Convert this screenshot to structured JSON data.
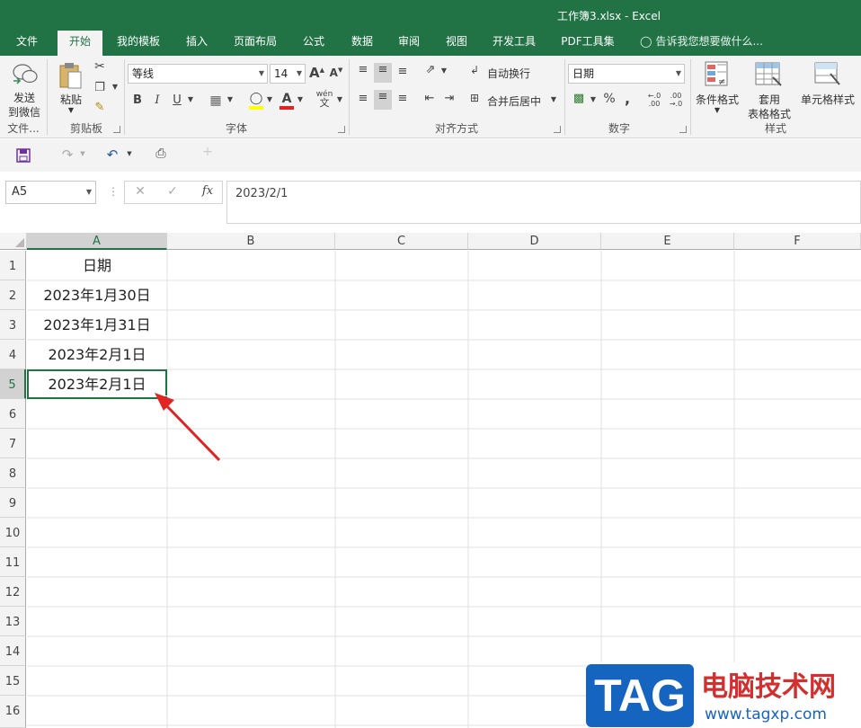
{
  "window": {
    "title": "工作簿3.xlsx - Excel"
  },
  "tabs": [
    {
      "label": "文件",
      "active": false
    },
    {
      "label": "开始",
      "active": true
    },
    {
      "label": "我的模板",
      "active": false
    },
    {
      "label": "插入",
      "active": false
    },
    {
      "label": "页面布局",
      "active": false
    },
    {
      "label": "公式",
      "active": false
    },
    {
      "label": "数据",
      "active": false
    },
    {
      "label": "审阅",
      "active": false
    },
    {
      "label": "视图",
      "active": false
    },
    {
      "label": "开发工具",
      "active": false
    },
    {
      "label": "PDF工具集",
      "active": false
    }
  ],
  "tell_me": "告诉我您想要做什么...",
  "ribbon": {
    "wechat": {
      "label1": "发送",
      "label2": "到微信",
      "group": "文件..."
    },
    "clipboard": {
      "paste": "粘贴",
      "group": "剪贴板"
    },
    "font": {
      "name": "等线",
      "size": "14",
      "group": "字体",
      "bold": "B",
      "italic": "I",
      "underline": "U",
      "grow": "A",
      "shrink": "A",
      "wen": "wén",
      "wen2": "文"
    },
    "alignment": {
      "wrap": "自动换行",
      "merge": "合并后居中",
      "group": "对齐方式"
    },
    "number": {
      "format": "日期",
      "percent": "%",
      "comma": ",",
      "group": "数字"
    },
    "styles": {
      "conditional": "条件格式",
      "table1": "套用",
      "table2": "表格格式",
      "cell": "单元格样式",
      "group": "样式"
    }
  },
  "formula_bar": {
    "name_box": "A5",
    "fx": "fx",
    "content": "2023/2/1"
  },
  "columns": [
    "A",
    "B",
    "C",
    "D",
    "E",
    "F"
  ],
  "rows": [
    "1",
    "2",
    "3",
    "4",
    "5",
    "6",
    "7",
    "8",
    "9",
    "10",
    "11",
    "12",
    "13",
    "14",
    "15",
    "16"
  ],
  "cells": {
    "A1": "日期",
    "A2": "2023年1月30日",
    "A3": "2023年1月31日",
    "A4": "2023年2月1日",
    "A5": "2023年2月1日"
  },
  "selected_cell": "A5",
  "watermark": {
    "tag": "TAG",
    "site_name": "电脑技术网",
    "url": "www.tagxp.com"
  },
  "colors": {
    "excel_green": "#217346",
    "arrow_red": "#e02424",
    "tag_blue": "#1565c0",
    "site_red": "#d32f2f"
  }
}
